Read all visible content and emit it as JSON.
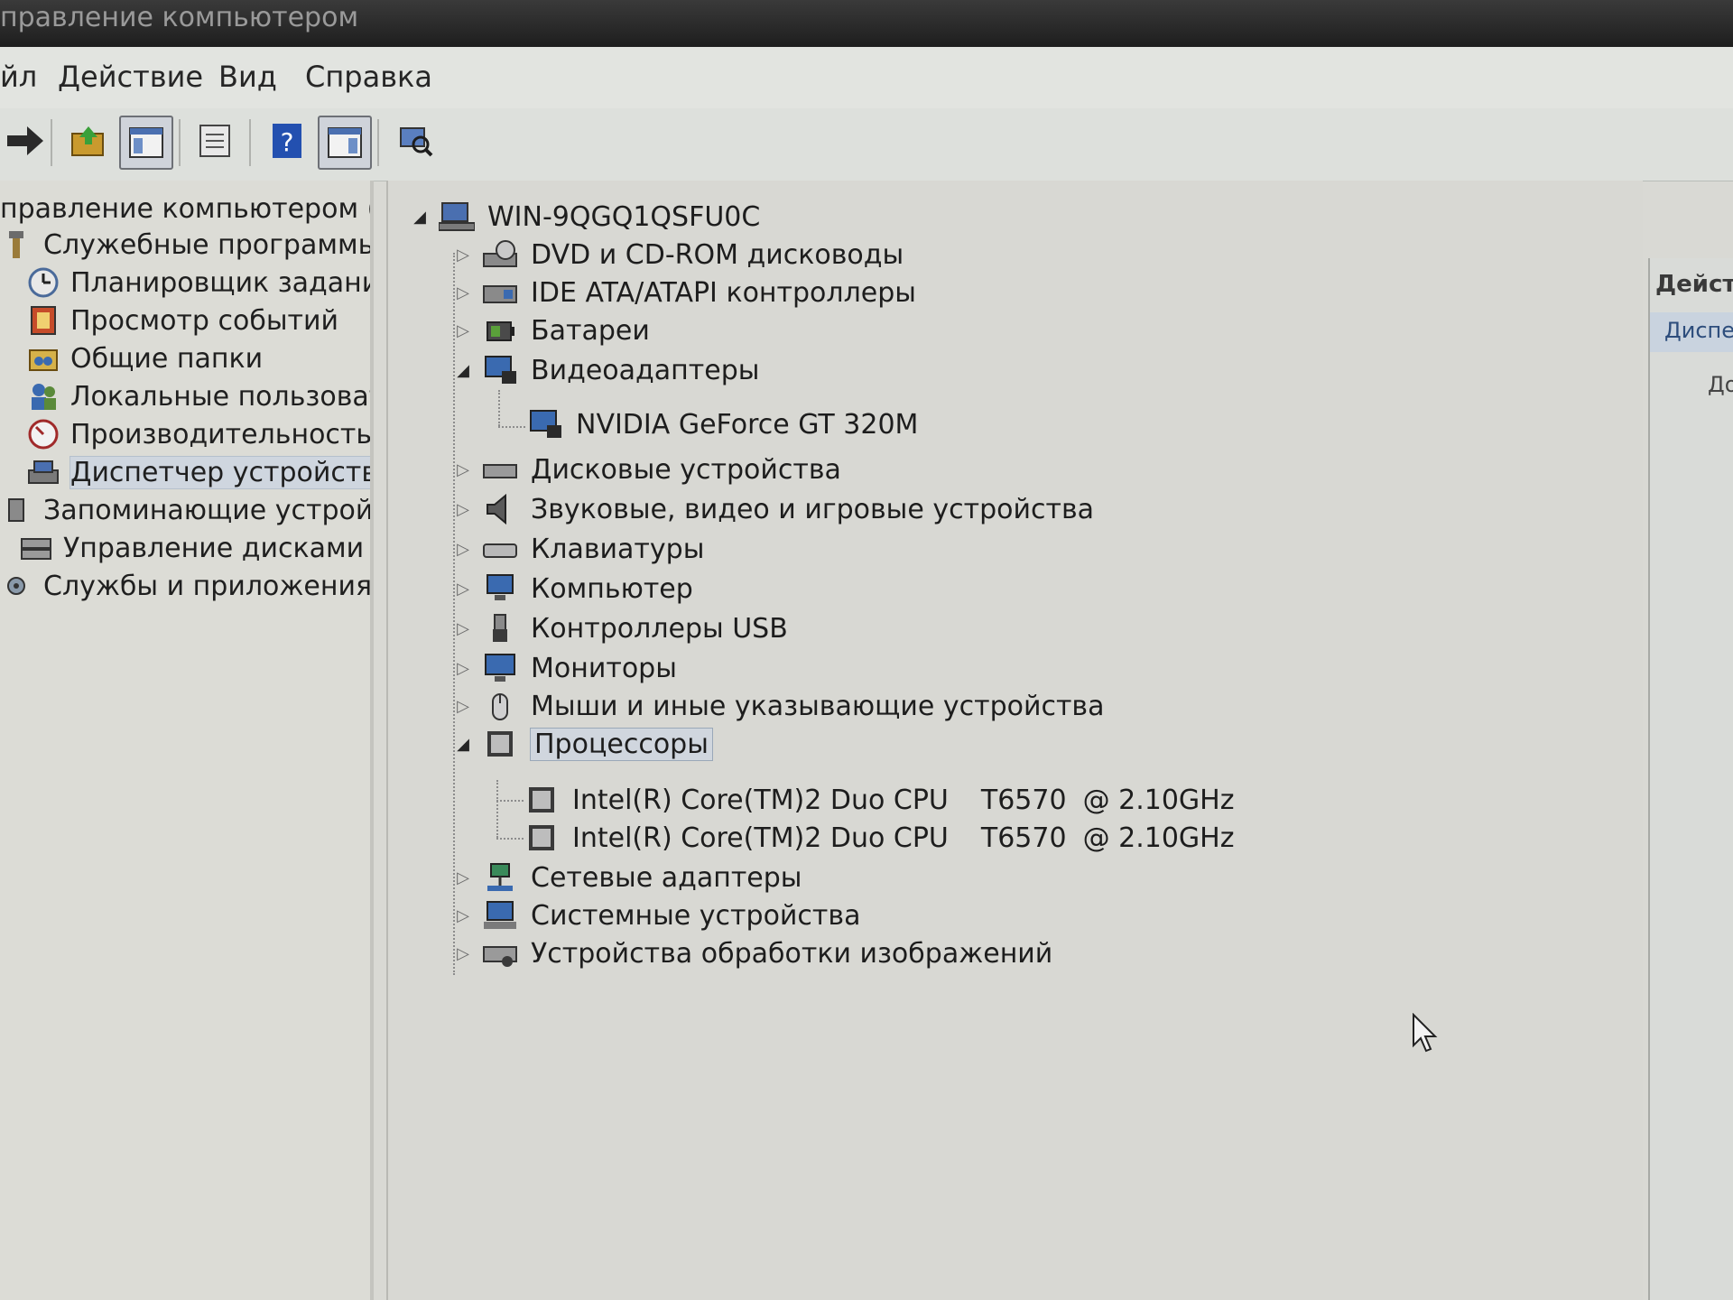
{
  "window": {
    "title": "правление компьютером"
  },
  "menu": {
    "file": "йл",
    "action": "Действие",
    "view": "Вид",
    "help": "Справка"
  },
  "toolbar": {
    "buttons": [
      "forward-icon",
      "up-folder-icon",
      "show-tree-icon",
      "properties-icon",
      "help-icon",
      "action-pane-icon",
      "scan-hardware-icon"
    ]
  },
  "left_tree": {
    "root": "правление компьютером (л",
    "items": [
      {
        "label": "Служебные программы",
        "icon": "tools-icon"
      },
      {
        "label": "Планировщик заданий",
        "icon": "clock-icon"
      },
      {
        "label": "Просмотр событий",
        "icon": "event-viewer-icon"
      },
      {
        "label": "Общие папки",
        "icon": "shared-folder-icon"
      },
      {
        "label": "Локальные пользовате",
        "icon": "users-icon"
      },
      {
        "label": "Производительность",
        "icon": "performance-icon"
      },
      {
        "label": "Диспетчер устройств",
        "icon": "device-manager-icon"
      },
      {
        "label": "Запоминающие устройст",
        "icon": "storage-icon"
      },
      {
        "label": "Управление дисками",
        "icon": "disk-management-icon"
      },
      {
        "label": "Службы и приложения",
        "icon": "services-icon"
      }
    ]
  },
  "device_tree": {
    "computer_name": "WIN-9QGQ1QSFU0C",
    "categories": [
      {
        "label": "DVD и CD-ROM дисководы",
        "icon": "dvd-icon"
      },
      {
        "label": "IDE ATA/ATAPI контроллеры",
        "icon": "ide-controller-icon"
      },
      {
        "label": "Батареи",
        "icon": "battery-icon"
      },
      {
        "label": "Видеоадаптеры",
        "icon": "display-adapter-icon"
      },
      {
        "label": "Дисковые устройства",
        "icon": "disk-drive-icon"
      },
      {
        "label": "Звуковые, видео и игровые устройства",
        "icon": "sound-icon"
      },
      {
        "label": "Клавиатуры",
        "icon": "keyboard-icon"
      },
      {
        "label": "Компьютер",
        "icon": "computer-icon"
      },
      {
        "label": "Контроллеры USB",
        "icon": "usb-icon"
      },
      {
        "label": "Мониторы",
        "icon": "monitor-icon"
      },
      {
        "label": "Мыши и иные указывающие устройства",
        "icon": "mouse-icon"
      },
      {
        "label": "Процессоры",
        "icon": "processor-icon"
      },
      {
        "label": "Сетевые адаптеры",
        "icon": "network-adapter-icon"
      },
      {
        "label": "Системные устройства",
        "icon": "system-devices-icon"
      },
      {
        "label": "Устройства обработки изображений",
        "icon": "imaging-devices-icon"
      }
    ],
    "video_adapter": "NVIDIA GeForce GT 320M",
    "processors": [
      {
        "name": "Intel(R) Core(TM)2 Duo CPU",
        "model": "T6570",
        "freq": "@ 2.10GHz"
      },
      {
        "name": "Intel(R) Core(TM)2 Duo CPU",
        "model": "T6570",
        "freq": "@ 2.10GHz"
      }
    ]
  },
  "actions_pane": {
    "header": "Дейст",
    "selected": "Диспет",
    "more": "До"
  }
}
